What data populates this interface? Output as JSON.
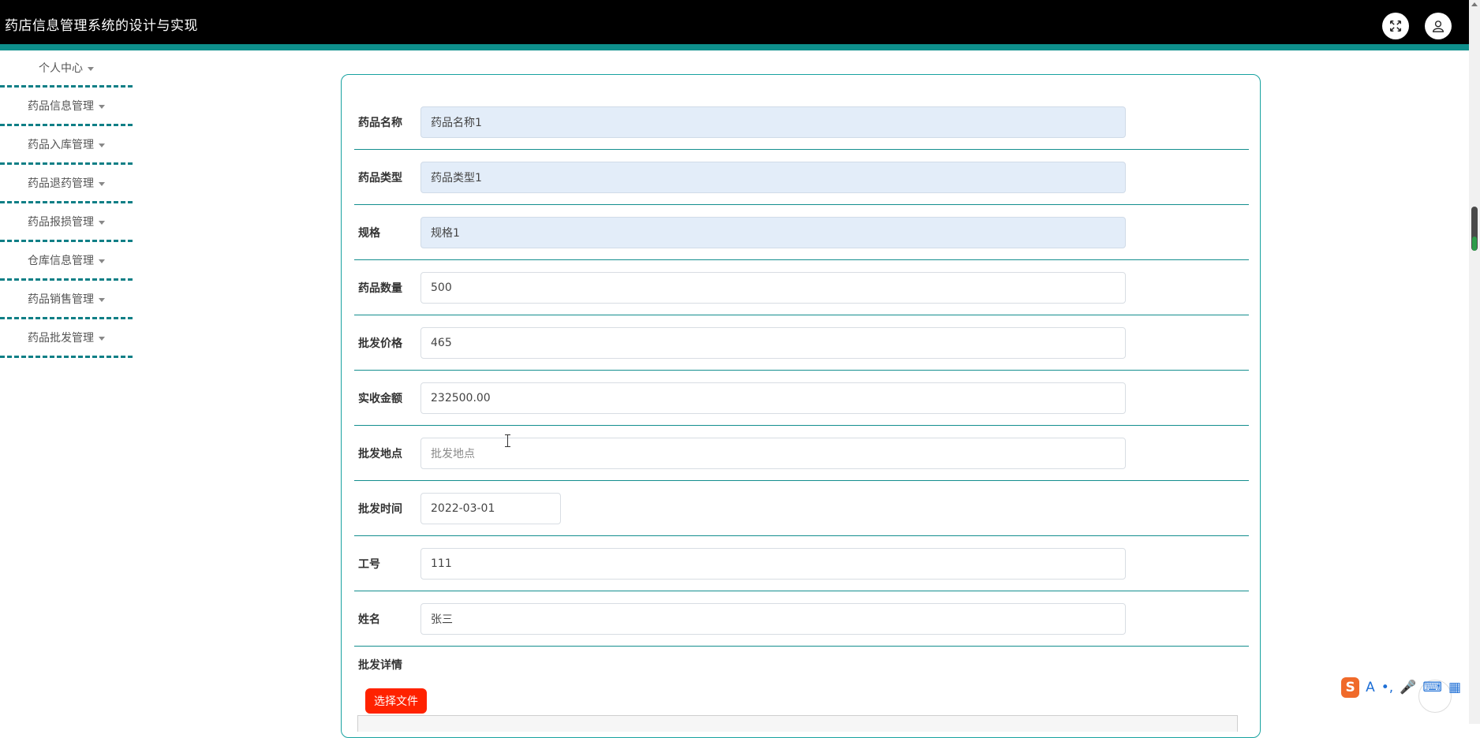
{
  "app": {
    "title": "药店信息管理系统的设计与实现"
  },
  "header": {
    "fullscreen_icon": "fullscreen-icon",
    "user_icon": "user-icon"
  },
  "sidebar": {
    "items": [
      {
        "label": "个人中心"
      },
      {
        "label": "药品信息管理"
      },
      {
        "label": "药品入库管理"
      },
      {
        "label": "药品退药管理"
      },
      {
        "label": "药品报损管理"
      },
      {
        "label": "仓库信息管理"
      },
      {
        "label": "药品销售管理"
      },
      {
        "label": "药品批发管理"
      }
    ]
  },
  "form": {
    "fields": [
      {
        "label": "药品名称",
        "value": "药品名称1",
        "readonly": true
      },
      {
        "label": "药品类型",
        "value": "药品类型1",
        "readonly": true
      },
      {
        "label": "规格",
        "value": "规格1",
        "readonly": true
      },
      {
        "label": "药品数量",
        "value": "500"
      },
      {
        "label": "批发价格",
        "value": "465"
      },
      {
        "label": "实收金额",
        "value": "232500.00"
      },
      {
        "label": "批发地点",
        "value": "",
        "placeholder": "批发地点"
      },
      {
        "label": "批发时间",
        "value": "2022-03-01"
      },
      {
        "label": "工号",
        "value": "111"
      },
      {
        "label": "姓名",
        "value": "张三"
      }
    ],
    "detail_label": "批发详情",
    "file_button": "选择文件"
  },
  "ime": {
    "letter": "A",
    "logo": "S"
  },
  "colors": {
    "accent": "#0e8f8c",
    "header_bg": "#000000",
    "file_button": "#ff2200",
    "readonly_bg": "#e3edf9"
  }
}
